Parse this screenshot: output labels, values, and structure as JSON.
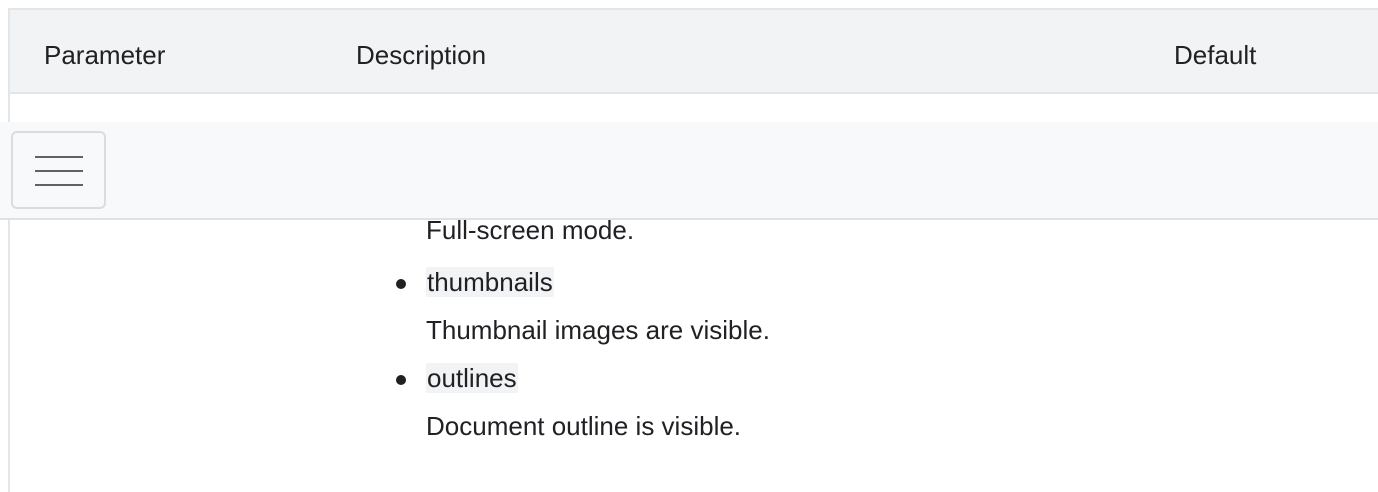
{
  "table": {
    "headers": {
      "parameter": "Parameter",
      "description": "Description",
      "default": "Default"
    },
    "description_items": [
      {
        "continuation": "Full-screen mode."
      },
      {
        "code": "thumbnails",
        "text": "Thumbnail images are visible."
      },
      {
        "code": "outlines",
        "text": "Document outline is visible."
      }
    ]
  },
  "toolbar": {
    "menu_icon": "hamburger-menu-icon"
  },
  "colors": {
    "header_bg": "#f1f3f4",
    "toolbar_bg": "#f8f9fa",
    "border": "#e3e6e8",
    "text": "#202124",
    "code_bg": "#f1f3f4"
  }
}
